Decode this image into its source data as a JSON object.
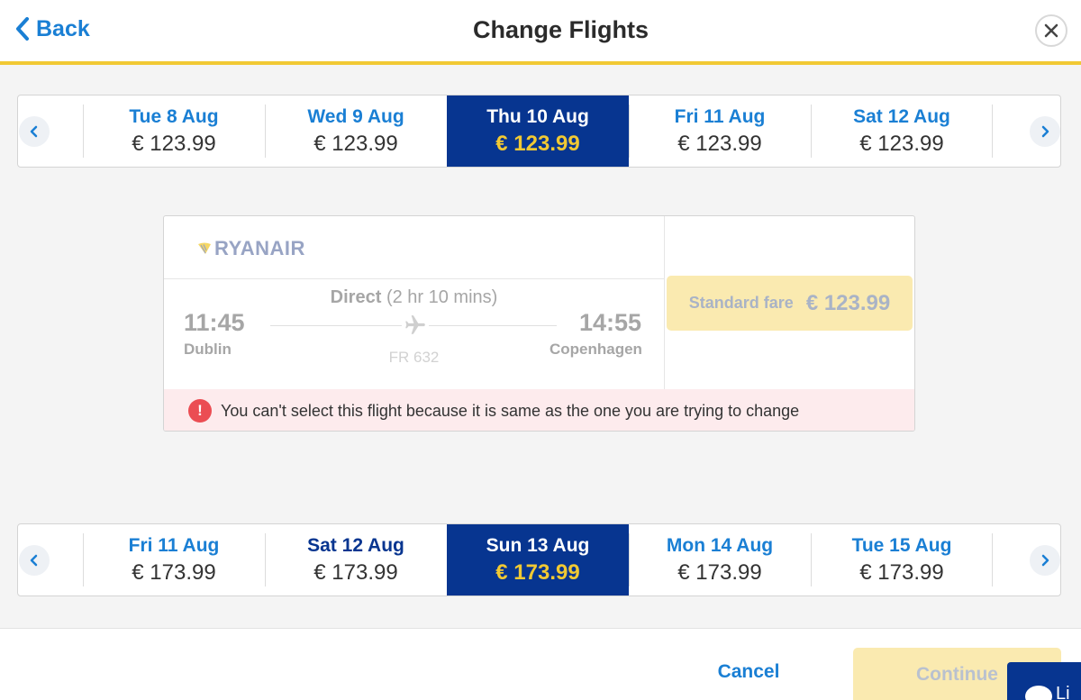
{
  "header": {
    "back_label": "Back",
    "title": "Change Flights"
  },
  "outbound_dates": [
    {
      "label": "Tue 8 Aug",
      "price": "€ 123.99",
      "selected": false
    },
    {
      "label": "Wed 9 Aug",
      "price": "€ 123.99",
      "selected": false
    },
    {
      "label": "Thu 10 Aug",
      "price": "€ 123.99",
      "selected": true
    },
    {
      "label": "Fri 11 Aug",
      "price": "€ 123.99",
      "selected": false
    },
    {
      "label": "Sat 12 Aug",
      "price": "€ 123.99",
      "selected": false
    }
  ],
  "flight": {
    "airline": "RYANAIR",
    "route_type": "Direct",
    "duration": "(2 hr 10 mins)",
    "departure_time": "11:45",
    "departure_city": "Dublin",
    "arrival_time": "14:55",
    "arrival_city": "Copenhagen",
    "flight_number": "FR 632",
    "fare_name": "Standard fare",
    "fare_price": "€ 123.99",
    "warning_icon": "!",
    "warning": "You can't select this flight because it is same as the one you are trying to change"
  },
  "return_dates": [
    {
      "label": "Fri 11 Aug",
      "price": "€ 173.99",
      "selected": false
    },
    {
      "label": "Sat 12 Aug",
      "price": "€ 173.99",
      "selected": false
    },
    {
      "label": "Sun 13 Aug",
      "price": "€ 173.99",
      "selected": true
    },
    {
      "label": "Mon 14 Aug",
      "price": "€ 173.99",
      "selected": false
    },
    {
      "label": "Tue 15 Aug",
      "price": "€ 173.99",
      "selected": false
    }
  ],
  "footer": {
    "cancel_label": "Cancel",
    "continue_label": "Continue",
    "chat_label": "Li"
  },
  "colors": {
    "primary_blue": "#073590",
    "link_blue": "#1a7fd4",
    "accent_yellow": "#f1c933",
    "warning_red": "#eb4d53"
  }
}
